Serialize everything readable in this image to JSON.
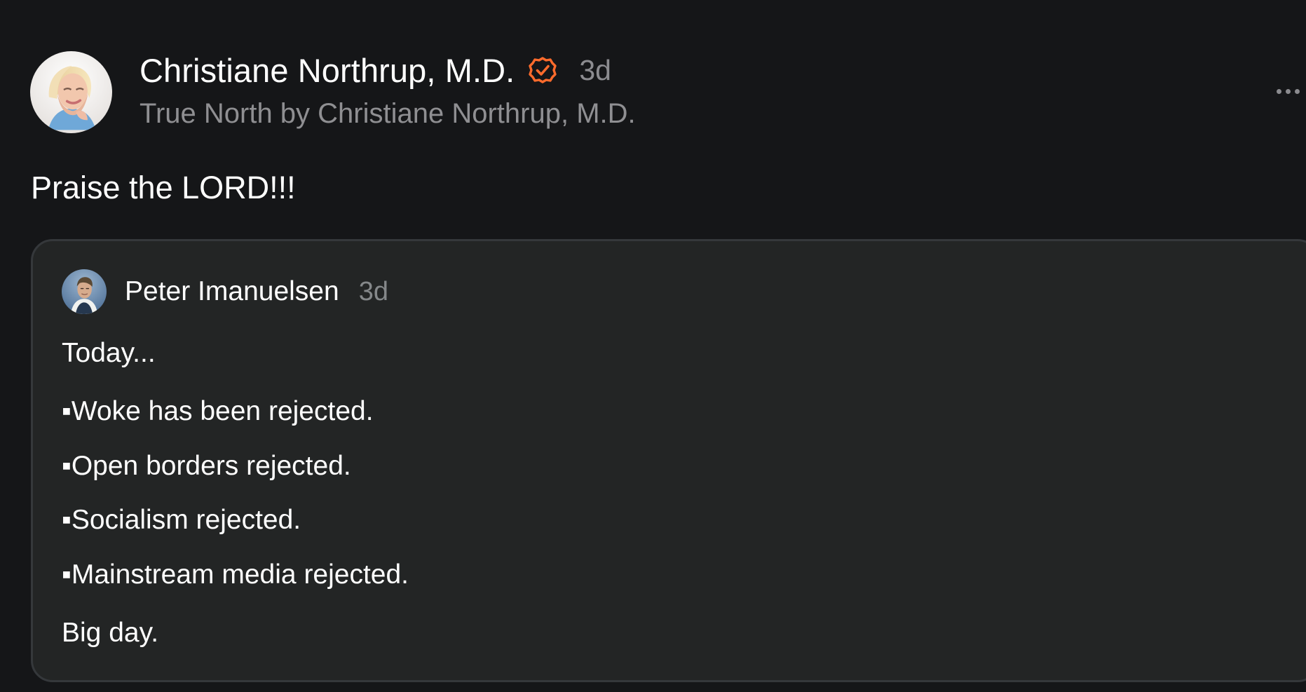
{
  "post": {
    "author": {
      "name": "Christiane Northrup, M.D.",
      "publication": "True North by Christiane Northrup, M.D.",
      "time": "3d",
      "avatar": "profile-photo-christiane",
      "verified_icon": "verified-badge-icon",
      "verified_color": "#ff6b2c"
    },
    "text": "Praise the LORD!!!",
    "menu_icon": "more-options-icon",
    "quoted_post": {
      "author": {
        "name": "Peter Imanuelsen",
        "time": "3d",
        "avatar": "profile-photo-peter"
      },
      "lines": [
        "Today...",
        "▪Woke has been rejected.",
        "▪Open borders rejected.",
        "▪Socialism rejected.",
        "▪Mainstream media rejected.",
        "Big day."
      ]
    }
  },
  "colors": {
    "background": "#151618",
    "card_background": "#232525",
    "card_border": "#35383b",
    "primary_text": "#ffffff",
    "secondary_text": "#8f8f92",
    "accent": "#ff6b2c"
  }
}
